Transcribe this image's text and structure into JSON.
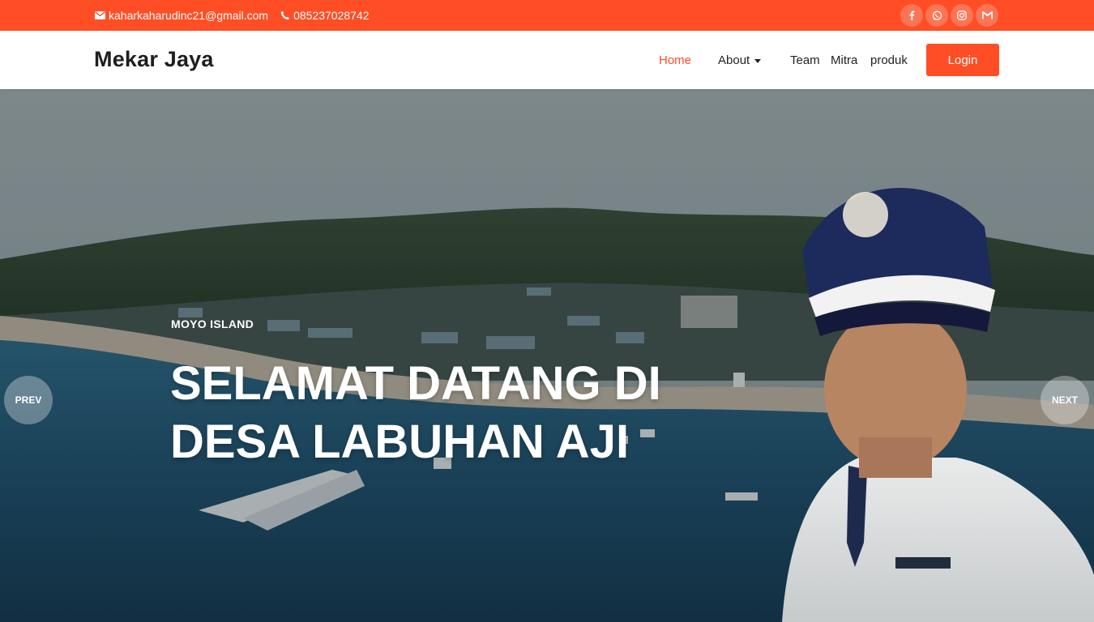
{
  "topbar": {
    "email": "kaharkaharudinc21@gmail.com",
    "phone": "085237028742",
    "email_icon": "envelope-icon",
    "phone_icon": "phone-icon",
    "socials": [
      {
        "name": "facebook-icon"
      },
      {
        "name": "whatsapp-icon"
      },
      {
        "name": "instagram-icon"
      },
      {
        "name": "gmail-icon"
      }
    ]
  },
  "nav": {
    "brand": "Mekar Jaya",
    "items": [
      {
        "label": "Home",
        "active": true
      },
      {
        "label": "About",
        "dropdown": true
      },
      {
        "label": "Team"
      },
      {
        "label": "Mitra"
      },
      {
        "label": "produk"
      }
    ],
    "login_label": "Login"
  },
  "hero": {
    "eyebrow": "MOYO ISLAND",
    "title_line1": "SELAMAT DATANG DI",
    "title_line2": "DESA LABUHAN AJI",
    "prev_label": "PREV",
    "next_label": "NEXT"
  },
  "colors": {
    "accent": "#ff4e25",
    "brand_text": "#1e1e1e"
  }
}
